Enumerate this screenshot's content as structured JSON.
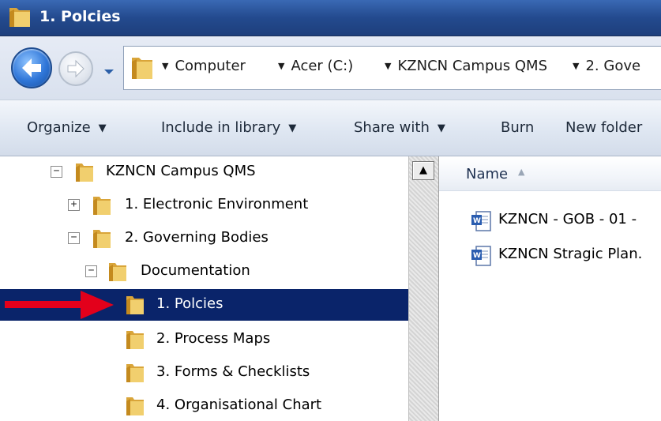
{
  "window": {
    "title": "1. Polcies"
  },
  "address_bar": {
    "crumbs": [
      "Computer",
      "Acer (C:)",
      "KZNCN Campus QMS",
      "2. Gove"
    ]
  },
  "command_bar": {
    "organize": "Organize",
    "include_in_library": "Include in library",
    "share_with": "Share with",
    "burn": "Burn",
    "new_folder": "New folder"
  },
  "nav_tree": {
    "items": [
      {
        "label": "KZNCN Campus QMS",
        "expander": "−"
      },
      {
        "label": "1. Electronic Environment",
        "expander": "+"
      },
      {
        "label": "2. Governing Bodies",
        "expander": "−"
      },
      {
        "label": "Documentation",
        "expander": "−"
      },
      {
        "label": "1. Polcies",
        "selected": true
      },
      {
        "label": "2. Process Maps"
      },
      {
        "label": "3. Forms & Checklists"
      },
      {
        "label": "4. Organisational Chart"
      }
    ]
  },
  "file_list": {
    "column_name": "Name",
    "files": [
      {
        "name": "KZNCN - GOB - 01 -",
        "icon": "word-document-icon"
      },
      {
        "name": "KZNCN Stragic Plan.",
        "icon": "word-document-icon"
      }
    ]
  },
  "colors": {
    "title_bar": "#234a8e",
    "selection": "#0a246a",
    "annotation_arrow": "#e3001b",
    "folder": "#e8c35a"
  }
}
